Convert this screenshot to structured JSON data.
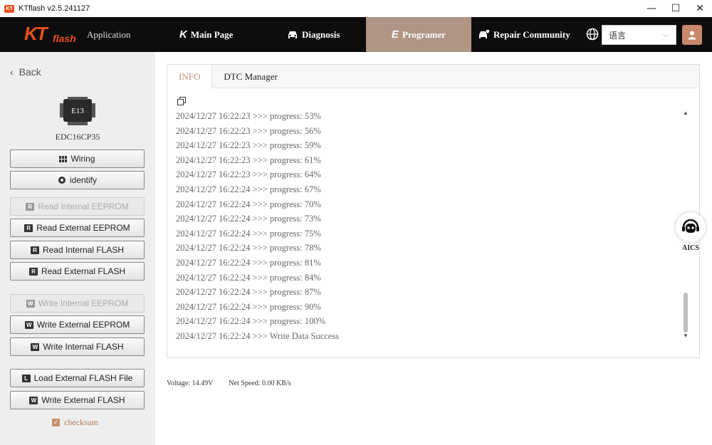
{
  "window": {
    "logo_text": "KT",
    "title": "KTflash v2.5.241127",
    "minimize": "—",
    "maximize": "☐",
    "close": "✕"
  },
  "nav": {
    "brand_kt": "KT",
    "brand_flash": "flash",
    "application": "Application",
    "items": [
      {
        "icon": "K",
        "label": "Main Page"
      },
      {
        "icon": "car-icon",
        "label": "Diagnosis"
      },
      {
        "icon": "E",
        "label": "Programer"
      },
      {
        "icon": "repair-car-icon",
        "label": "Repair Community"
      }
    ],
    "active_index": 2,
    "language": "语言"
  },
  "sidebar": {
    "back": "Back",
    "ecu_chip_label": "E13",
    "ecu_name": "EDC16CP35",
    "buttons": [
      {
        "label": "Wiring",
        "icon": "wiring-icon",
        "enabled": true
      },
      {
        "label": "identify",
        "icon": "identify-icon",
        "enabled": true
      },
      {
        "label": "Read Internal EEPROM",
        "icon": "R",
        "enabled": false
      },
      {
        "label": "Read External EEPROM",
        "icon": "R",
        "enabled": true
      },
      {
        "label": "Read Internal FLASH",
        "icon": "R",
        "enabled": true
      },
      {
        "label": "Read External FLASH",
        "icon": "R",
        "enabled": true
      },
      {
        "label": "Write Internal EEPROM",
        "icon": "W",
        "enabled": false
      },
      {
        "label": "Write External EEPROM",
        "icon": "W",
        "enabled": true
      },
      {
        "label": "Write Internal FLASH",
        "icon": "W",
        "enabled": true
      },
      {
        "label": "Load External FLASH File",
        "icon": "L",
        "enabled": true
      },
      {
        "label": "Write External FLASH",
        "icon": "W",
        "enabled": true
      }
    ],
    "checksum_label": "checksum",
    "checksum_checked": true
  },
  "tabs": [
    {
      "label": "INFO",
      "active": true
    },
    {
      "label": "DTC Manager",
      "active": false
    }
  ],
  "log": [
    "2024/12/27 16:22:23 >>> progress: 53%",
    "2024/12/27 16:22:23 >>> progress: 56%",
    "2024/12/27 16:22:23 >>> progress: 59%",
    "2024/12/27 16:22:23 >>> progress: 61%",
    "2024/12/27 16:22:23 >>> progress: 64%",
    "2024/12/27 16:22:24 >>> progress: 67%",
    "2024/12/27 16:22:24 >>> progress: 70%",
    "2024/12/27 16:22:24 >>> progress: 73%",
    "2024/12/27 16:22:24 >>> progress: 75%",
    "2024/12/27 16:22:24 >>> progress: 78%",
    "2024/12/27 16:22:24 >>> progress: 81%",
    "2024/12/27 16:22:24 >>> progress: 84%",
    "2024/12/27 16:22:24 >>> progress: 87%",
    "2024/12/27 16:22:24 >>> progress: 90%",
    "2024/12/27 16:22:24 >>> progress: 100%",
    "2024/12/27 16:22:24 >>> Write Data Success"
  ],
  "status": {
    "voltage_label": "Voltage:",
    "voltage_value": "14.49V",
    "net_speed_label": "Net Speed:",
    "net_speed_value": "0.00 KB/s"
  },
  "aics": {
    "label": "AICS"
  },
  "colors": {
    "accent": "#c0927a",
    "nav_bg": "#0d0d0d",
    "nav_active": "#b09484",
    "brand": "#e8501c"
  }
}
